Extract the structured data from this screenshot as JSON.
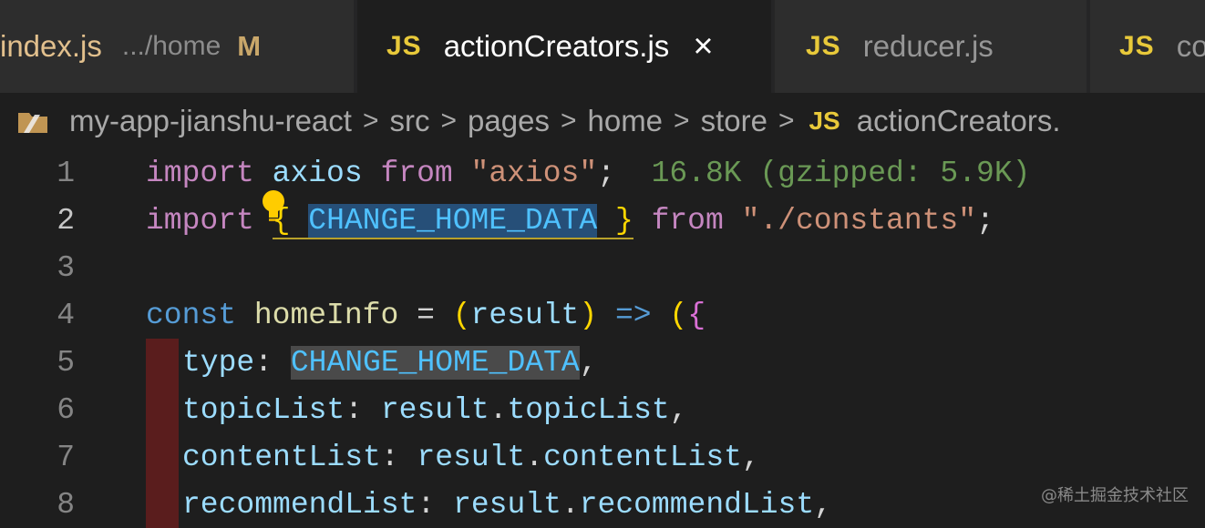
{
  "tabs": [
    {
      "name": "index.js",
      "path": ".../home",
      "status": "M",
      "active": false
    },
    {
      "icon": "JS",
      "name": "actionCreators.js",
      "close": "×",
      "active": true
    },
    {
      "icon": "JS",
      "name": "reducer.js",
      "active": false
    },
    {
      "icon": "JS",
      "name": "co",
      "active": false
    }
  ],
  "breadcrumb": {
    "items": [
      "my-app-jianshu-react",
      "src",
      "pages",
      "home",
      "store"
    ],
    "separator": ">",
    "file_icon": "JS",
    "file": "actionCreators."
  },
  "editor": {
    "line_numbers": [
      "1",
      "2",
      "3",
      "4",
      "5",
      "6",
      "7",
      "8"
    ],
    "line1": {
      "kw": "import",
      "id": "axios",
      "from": "from",
      "str": "\"axios\"",
      "semi": ";",
      "size": "16.8K (gzipped: 5.9K)"
    },
    "line2": {
      "kw": "import",
      "open": "{",
      "id": "CHANGE_HOME_DATA",
      "close": "}",
      "from": "from",
      "str": "\"./constants\"",
      "semi": ";"
    },
    "line4": {
      "kw": "const",
      "fn": "homeInfo",
      "eq": "=",
      "open": "(",
      "param": "result",
      "close": ")",
      "arrow": "=>",
      "paren": "(",
      "brace": "{"
    },
    "line5": {
      "key": "type",
      "colon": ":",
      "val": "CHANGE_HOME_DATA",
      "comma": ","
    },
    "line6": {
      "key": "topicList",
      "colon": ":",
      "obj": "result",
      "dot": ".",
      "prop": "topicList",
      "comma": ","
    },
    "line7": {
      "key": "contentList",
      "colon": ":",
      "obj": "result",
      "dot": ".",
      "prop": "contentList",
      "comma": ","
    },
    "line8": {
      "key": "recommendList",
      "colon": ":",
      "obj": "result",
      "dot": ".",
      "prop": "recommendList",
      "comma": ","
    }
  },
  "watermark": "@稀土掘金技术社区",
  "colors": {
    "js_icon": "#e8c93a",
    "selection": "#264f78",
    "keyword": "#c586c0",
    "string": "#ce9178",
    "identifier": "#9cdcfe"
  }
}
